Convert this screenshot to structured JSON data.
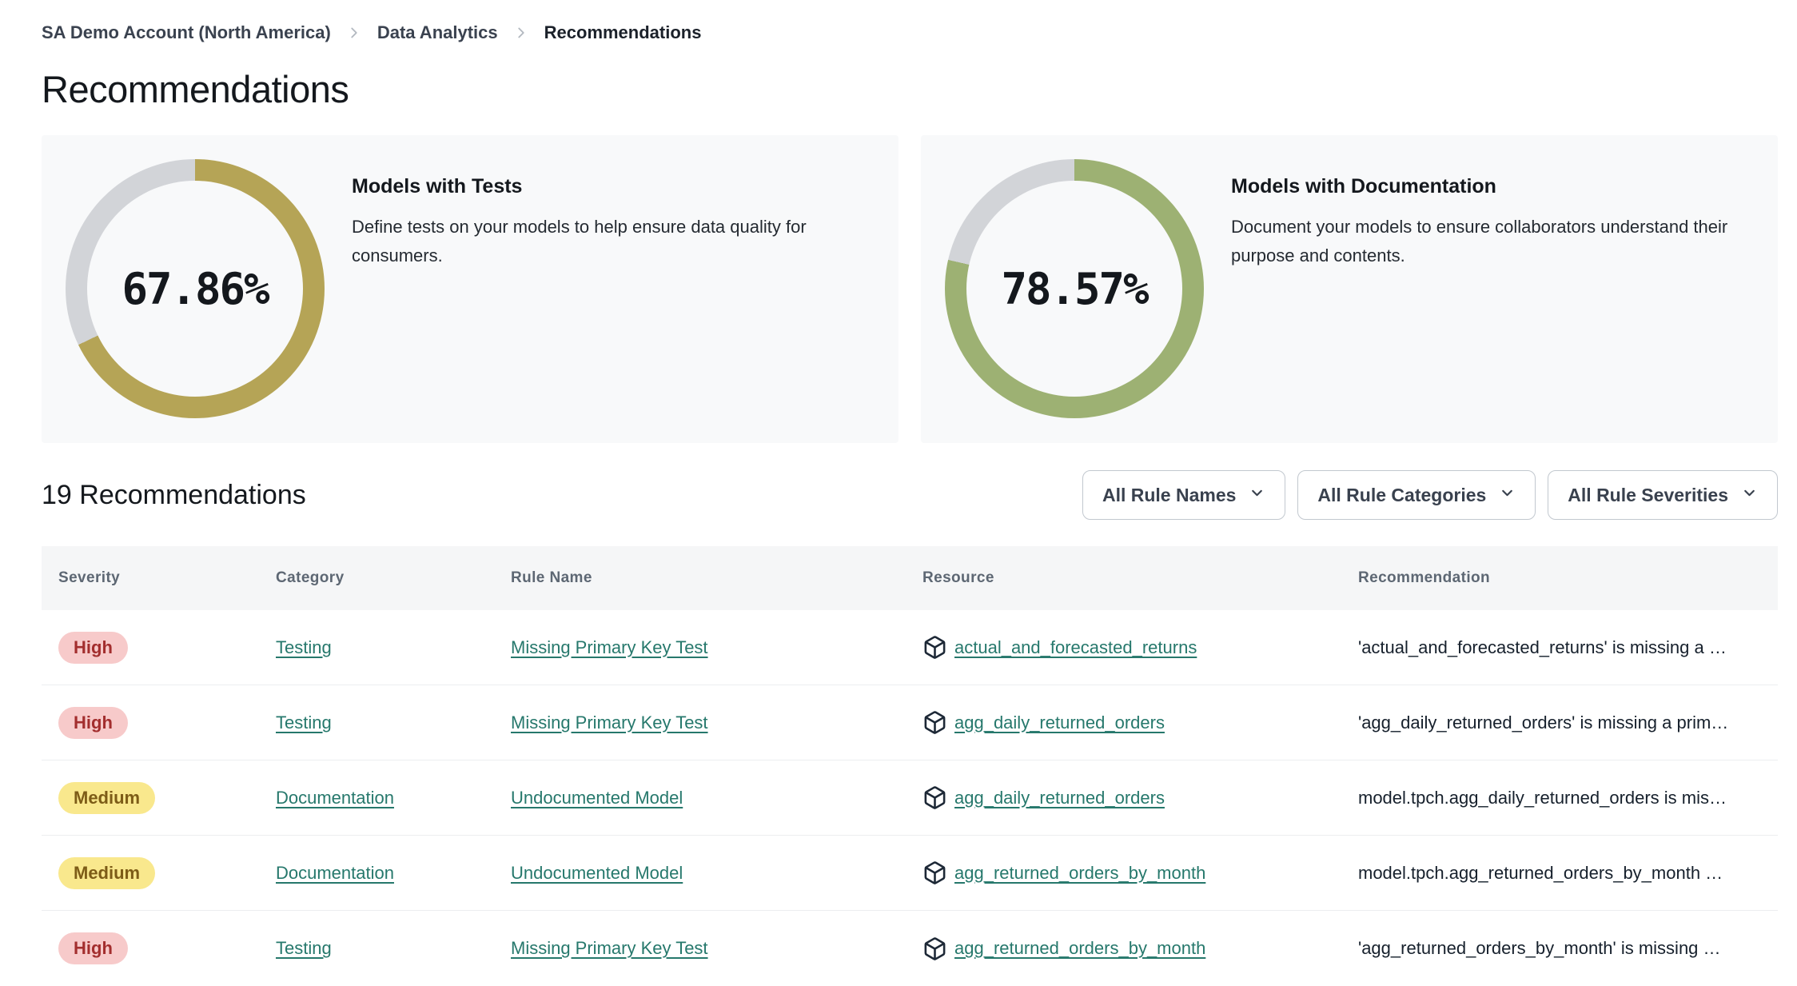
{
  "breadcrumb": {
    "items": [
      {
        "label": "SA Demo Account (North America)"
      },
      {
        "label": "Data Analytics"
      },
      {
        "label": "Recommendations"
      }
    ]
  },
  "page": {
    "title": "Recommendations"
  },
  "chart_data": [
    {
      "type": "donut",
      "title": "Models with Tests",
      "description": "Define tests on your models to help ensure data quality for consumers.",
      "value": 67.86,
      "label": "67.86%",
      "color": "#b5a456",
      "track_color": "#d2d4d8"
    },
    {
      "type": "donut",
      "title": "Models with Documentation",
      "description": "Document your models to ensure collaborators understand their purpose and contents.",
      "value": 78.57,
      "label": "78.57%",
      "color": "#9db173",
      "track_color": "#d2d4d8"
    }
  ],
  "list": {
    "heading": "19 Recommendations"
  },
  "filters": [
    {
      "label": "All Rule Names"
    },
    {
      "label": "All Rule Categories"
    },
    {
      "label": "All Rule Severities"
    }
  ],
  "table": {
    "columns": [
      "Severity",
      "Category",
      "Rule Name",
      "Resource",
      "Recommendation"
    ],
    "rows": [
      {
        "severity": "High",
        "severity_level": "high",
        "category": "Testing",
        "rule_name": "Missing Primary Key Test",
        "resource": "actual_and_forecasted_returns",
        "recommendation": "'actual_and_forecasted_returns' is missing a …"
      },
      {
        "severity": "High",
        "severity_level": "high",
        "category": "Testing",
        "rule_name": "Missing Primary Key Test",
        "resource": "agg_daily_returned_orders",
        "recommendation": "'agg_daily_returned_orders' is missing a prim…"
      },
      {
        "severity": "Medium",
        "severity_level": "medium",
        "category": "Documentation",
        "rule_name": "Undocumented Model",
        "resource": "agg_daily_returned_orders",
        "recommendation": "model.tpch.agg_daily_returned_orders is mis…"
      },
      {
        "severity": "Medium",
        "severity_level": "medium",
        "category": "Documentation",
        "rule_name": "Undocumented Model",
        "resource": "agg_returned_orders_by_month",
        "recommendation": "model.tpch.agg_returned_orders_by_month …"
      },
      {
        "severity": "High",
        "severity_level": "high",
        "category": "Testing",
        "rule_name": "Missing Primary Key Test",
        "resource": "agg_returned_orders_by_month",
        "recommendation": "'agg_returned_orders_by_month' is missing …"
      }
    ]
  },
  "icons": {
    "breadcrumb_separator": "chevron-right",
    "filter_dropdown": "chevron-down",
    "resource": "cube"
  },
  "colors": {
    "link": "#26786c",
    "severity_high_bg": "#f7caca",
    "severity_high_text": "#a32e2e",
    "severity_medium_bg": "#f9e88d",
    "severity_medium_text": "#7d5c17",
    "donut_tests": "#b5a456",
    "donut_docs": "#9db173",
    "donut_track": "#d2d4d8",
    "card_bg": "#f8f9fa",
    "table_header_bg": "#f5f6f7"
  }
}
